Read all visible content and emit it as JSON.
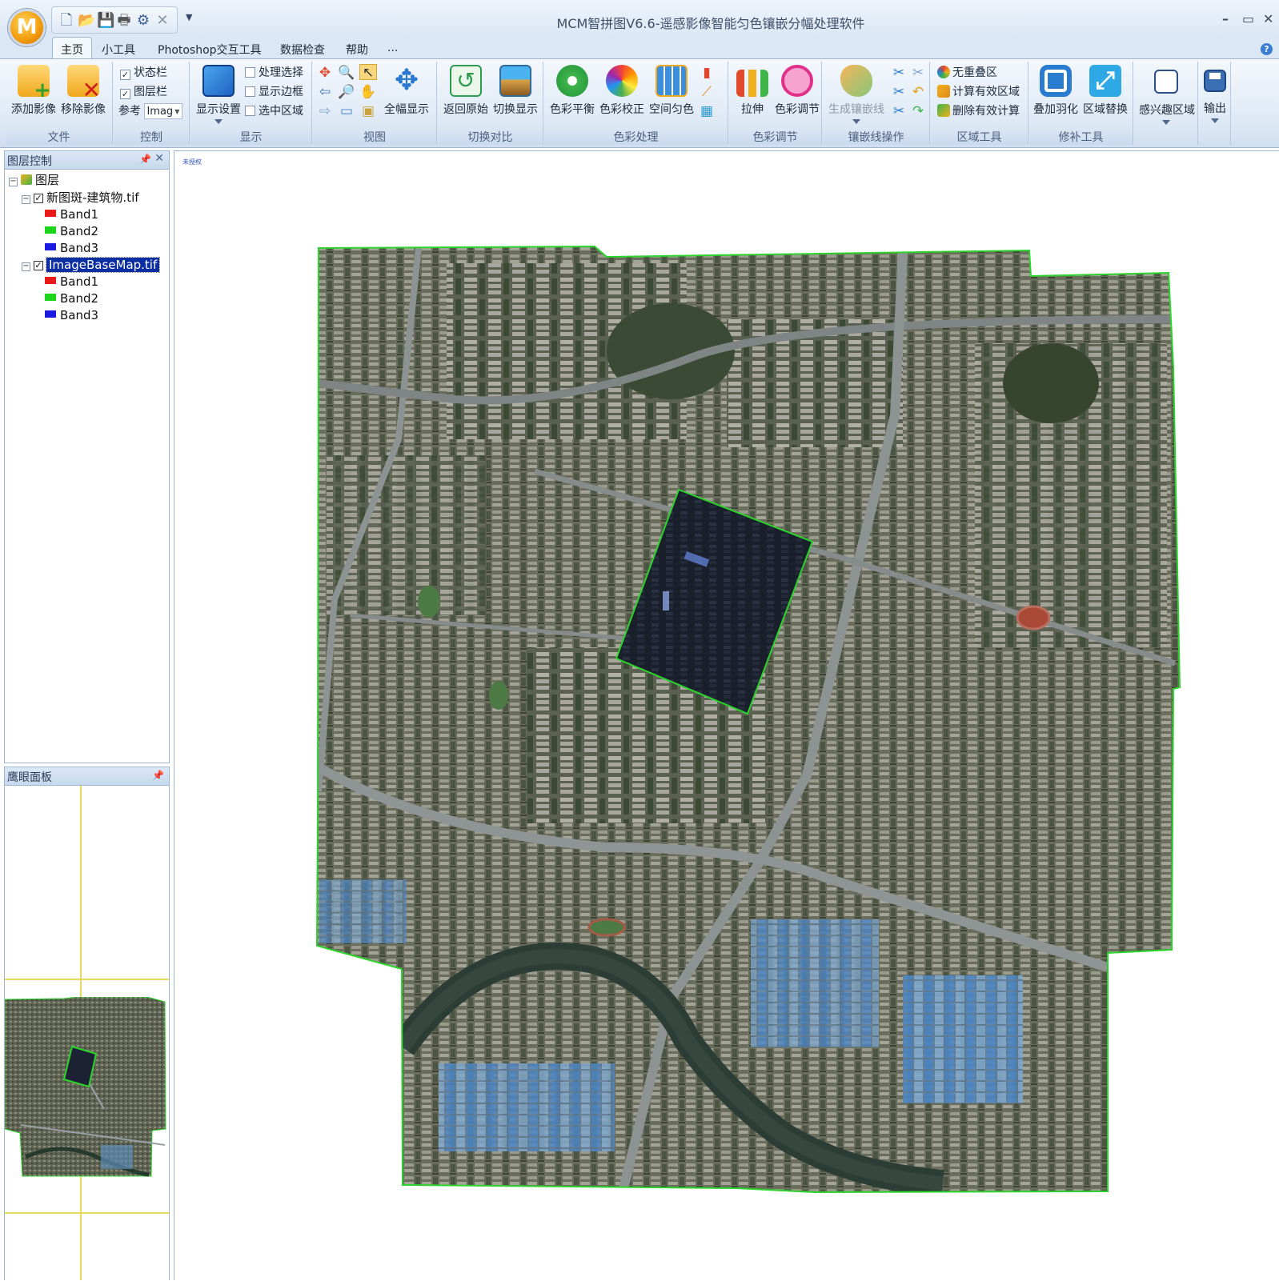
{
  "app": {
    "title": "MCM智拼图V6.6-遥感影像智能匀色镶嵌分幅处理软件",
    "logo_letter": "M"
  },
  "quick_access": [
    "new-file-icon",
    "open-folder-icon",
    "save-icon",
    "print-icon",
    "gear-icon",
    "close-icon"
  ],
  "window_controls": {
    "minimize": "–",
    "maximize": "▭",
    "close": "✕"
  },
  "tabs": [
    "主页",
    "小工具",
    "Photoshop交互工具",
    "数据检查",
    "帮助",
    "..."
  ],
  "ribbon": {
    "file": {
      "label": "文件",
      "add": "添加影像",
      "remove": "移除影像"
    },
    "control": {
      "label": "控制",
      "statusbar": "状态栏",
      "layerbar": "图层栏",
      "ref_label": "参考",
      "ref_value": "Imag"
    },
    "display": {
      "label": "显示",
      "settings": "显示设置",
      "process_select": "处理选择",
      "show_border": "显示边框",
      "select_region": "选中区域"
    },
    "view": {
      "label": "视图",
      "full_extent": "全幅显示"
    },
    "switch": {
      "label": "切换对比",
      "back_original": "返回原始",
      "switch_display": "切换显示"
    },
    "color": {
      "label": "色彩处理",
      "balance": "色彩平衡",
      "correction": "色彩校正",
      "spatial": "空间匀色"
    },
    "adjust": {
      "label": "色彩调节",
      "stretch": "拉伸",
      "color_adjust": "色彩调节"
    },
    "seam": {
      "label": "镶嵌线操作",
      "generate": "生成镶嵌线"
    },
    "region": {
      "label": "区域工具",
      "no_overlap": "无重叠区",
      "calc_valid": "计算有效区域",
      "delete_valid": "删除有效计算"
    },
    "repair": {
      "label": "修补工具",
      "feather": "叠加羽化",
      "replace": "区域替换"
    },
    "roi": {
      "label": "感兴趣区域"
    },
    "output": {
      "label": "输出"
    }
  },
  "layer_panel": {
    "title": "图层控制",
    "root": "图层",
    "layers": [
      {
        "name": "新图斑-建筑物.tif",
        "bands": [
          "Band1",
          "Band2",
          "Band3"
        ],
        "selected": false
      },
      {
        "name": "ImageBaseMap.tif",
        "bands": [
          "Band1",
          "Band2",
          "Band3"
        ],
        "selected": true
      }
    ],
    "band_colors": [
      "#e81a1a",
      "#1ad51a",
      "#1a1ae0"
    ]
  },
  "eagle_panel": {
    "title": "鹰眼面板"
  },
  "viewport": {
    "watermark": "未授权"
  },
  "colors": {
    "boundary": "#2bd42b",
    "ribbon_bg": "#dde8f5",
    "selection": "#0b2fa3"
  }
}
